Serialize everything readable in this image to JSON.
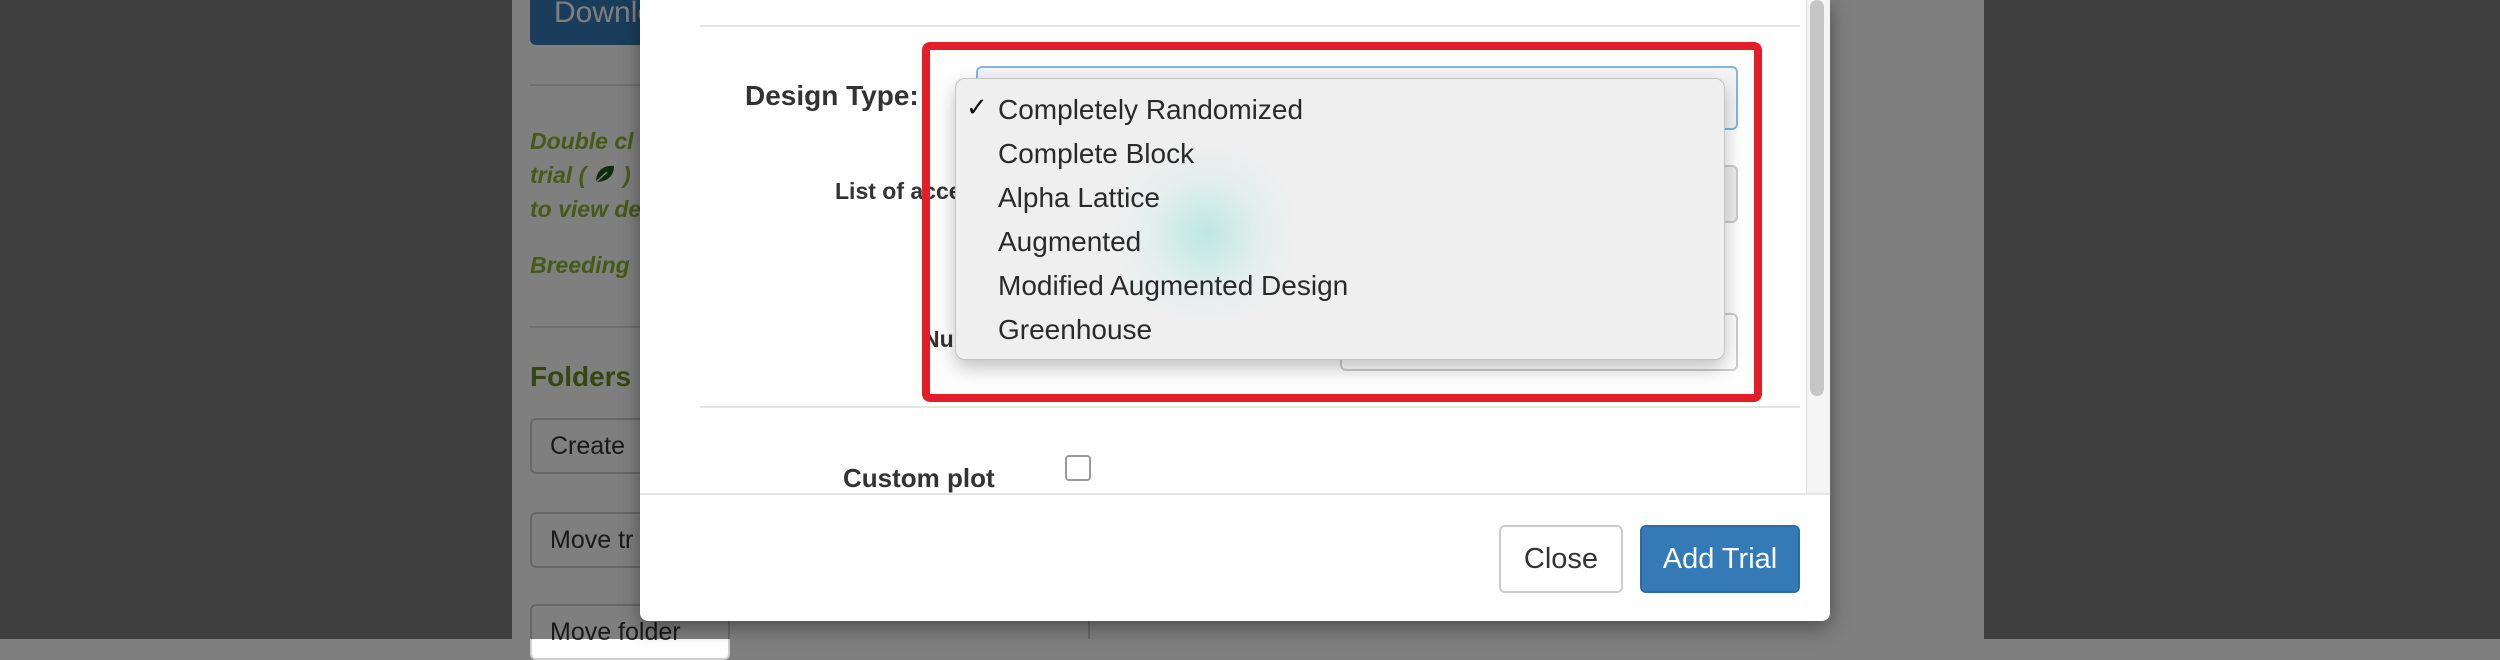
{
  "background": {
    "download_button": "Download",
    "help_text": [
      "Double cl",
      "trial ( ",
      " )",
      "to view de"
    ],
    "breeding_text": "Breeding",
    "folders_heading": "Folders",
    "buttons": [
      "Create",
      "Move tr",
      "Move folder"
    ]
  },
  "modal": {
    "design_type_label": "Design Type:",
    "accessions_label": "List of acce",
    "num_label": "Nu",
    "custom_plot_label": "Custom plot",
    "design_dropdown": {
      "selected": "Completely Randomized",
      "options": [
        "Completely Randomized",
        "Complete Block",
        "Alpha Lattice",
        "Augmented",
        "Modified Augmented Design",
        "Greenhouse"
      ]
    },
    "footer": {
      "close_label": "Close",
      "add_trial_label": "Add Trial"
    }
  },
  "colors": {
    "highlight": "#e41e26",
    "primary_button": "#337ab7",
    "help_text_green": "#8bb42a"
  }
}
